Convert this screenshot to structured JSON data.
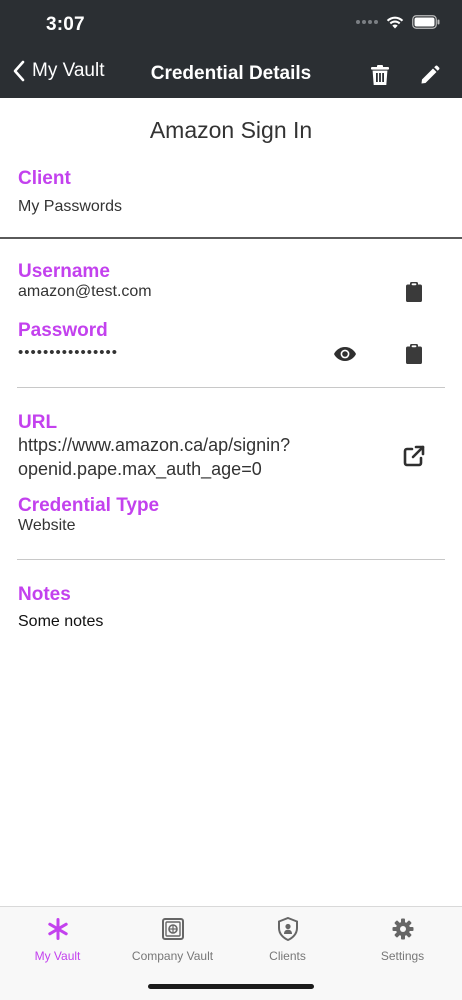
{
  "status_bar": {
    "time": "3:07"
  },
  "nav": {
    "back_label": "My Vault",
    "title": "Credential Details"
  },
  "credential": {
    "name": "Amazon Sign In",
    "client_label": "Client",
    "client_value": "My Passwords",
    "username_label": "Username",
    "username_value": "amazon@test.com",
    "password_label": "Password",
    "password_value": "••••••••••••••••",
    "url_label": "URL",
    "url_value": "https://www.amazon.ca/ap/signin?openid.pape.max_auth_age=0",
    "type_label": "Credential Type",
    "type_value": "Website",
    "notes_label": "Notes",
    "notes_value": "Some notes"
  },
  "tabs": [
    {
      "label": "My Vault",
      "icon": "asterisk-icon",
      "active": true
    },
    {
      "label": "Company Vault",
      "icon": "safe-icon",
      "active": false
    },
    {
      "label": "Clients",
      "icon": "shield-icon",
      "active": false
    },
    {
      "label": "Settings",
      "icon": "gear-icon",
      "active": false
    }
  ],
  "colors": {
    "accent": "#c341ee",
    "header_bg": "#2b2f33"
  }
}
